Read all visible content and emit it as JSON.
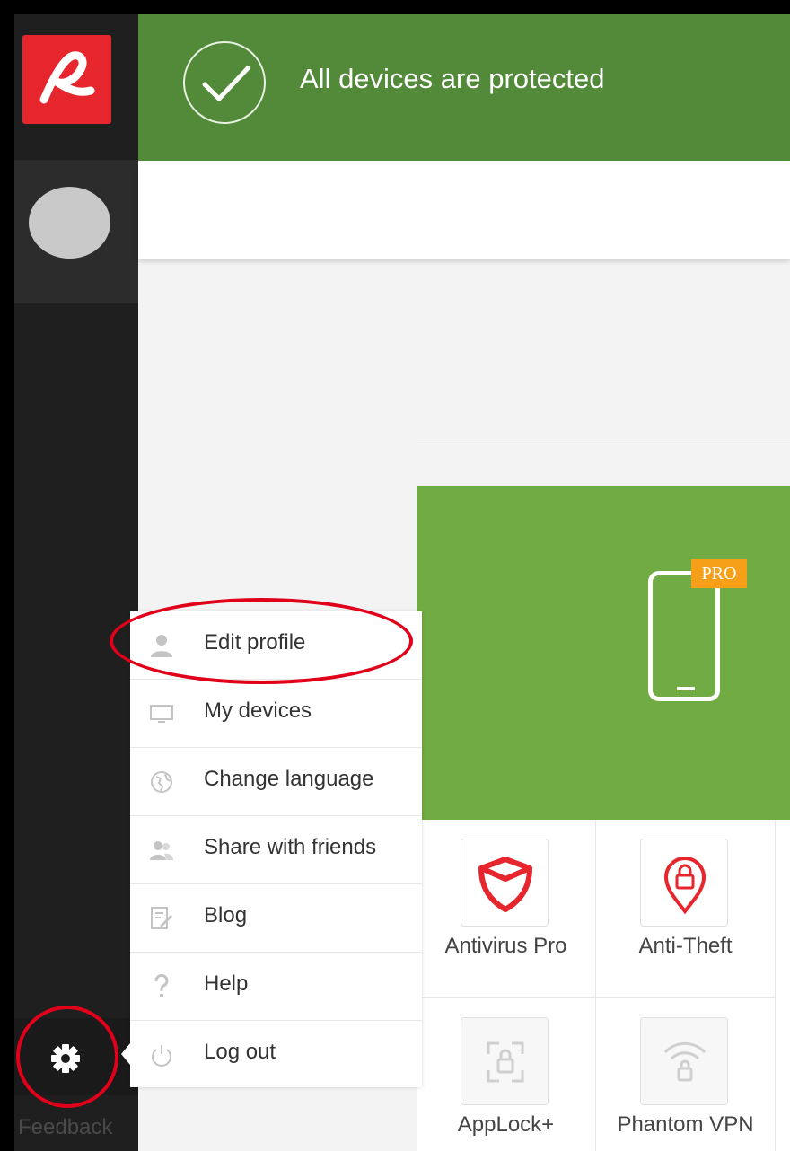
{
  "banner": {
    "status_text": "All devices are protected"
  },
  "sidebar": {
    "feedback_label": "Feedback"
  },
  "device_card": {
    "badge": "PRO"
  },
  "apps": [
    {
      "label": "Antivirus Pro",
      "icon": "shield-icon",
      "enabled": true
    },
    {
      "label": "Anti-Theft",
      "icon": "location-lock-icon",
      "enabled": true
    },
    {
      "label": "AppLock+",
      "icon": "applock-icon",
      "enabled": false
    },
    {
      "label": "Phantom VPN",
      "icon": "wifi-lock-icon",
      "enabled": false
    }
  ],
  "menu": {
    "items": [
      {
        "label": "Edit profile",
        "icon": "user-icon"
      },
      {
        "label": "My devices",
        "icon": "monitor-icon"
      },
      {
        "label": "Change language",
        "icon": "globe-icon"
      },
      {
        "label": "Share with friends",
        "icon": "users-icon"
      },
      {
        "label": "Blog",
        "icon": "edit-doc-icon"
      },
      {
        "label": "Help",
        "icon": "question-icon"
      },
      {
        "label": "Log out",
        "icon": "power-icon"
      }
    ]
  },
  "colors": {
    "brand_red": "#e6252d",
    "banner_green": "#528a39",
    "card_green": "#71ab44",
    "pro_orange": "#f6a01a",
    "annotation_red": "#e0001a"
  }
}
